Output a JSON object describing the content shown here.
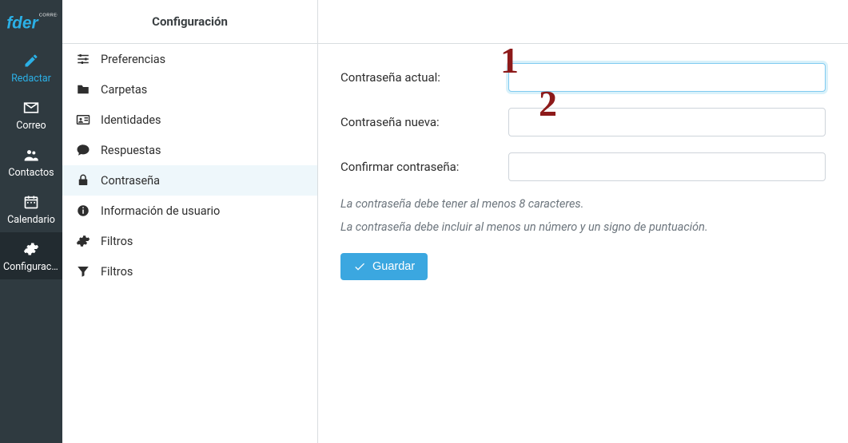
{
  "logo": {
    "brand_main": "fder",
    "brand_tag": "CORREO"
  },
  "rail": {
    "items": [
      {
        "label": "Redactar",
        "icon": "compose-icon",
        "active": true
      },
      {
        "label": "Correo",
        "icon": "mail-icon"
      },
      {
        "label": "Contactos",
        "icon": "contacts-icon"
      },
      {
        "label": "Calendario",
        "icon": "calendar-icon"
      },
      {
        "label": "Configuraci...",
        "icon": "gear-icon",
        "selected": true
      }
    ]
  },
  "settings": {
    "header": "Configuración",
    "items": [
      {
        "label": "Preferencias",
        "icon": "sliders-icon"
      },
      {
        "label": "Carpetas",
        "icon": "folder-icon"
      },
      {
        "label": "Identidades",
        "icon": "id-card-icon"
      },
      {
        "label": "Respuestas",
        "icon": "speech-icon"
      },
      {
        "label": "Contraseña",
        "icon": "lock-icon",
        "selected": true
      },
      {
        "label": "Información de usuario",
        "icon": "info-icon"
      },
      {
        "label": "Filtros",
        "icon": "gear-icon"
      },
      {
        "label": "Filtros",
        "icon": "funnel-icon"
      }
    ]
  },
  "form": {
    "current_label": "Contraseña actual:",
    "new_label": "Contraseña nueva:",
    "confirm_label": "Confirmar contraseña:",
    "current_value": "",
    "new_value": "",
    "confirm_value": "",
    "hint1": "La contraseña debe tener al menos 8 caracteres.",
    "hint2": "La contraseña debe incluir al menos un número y un signo de puntuación.",
    "save_label": "Guardar"
  },
  "annotations": {
    "one": "1",
    "two": "2"
  },
  "colors": {
    "accent": "#2bb0e6",
    "rail_bg": "#2f3a40",
    "anno": "#8d1a1a"
  }
}
